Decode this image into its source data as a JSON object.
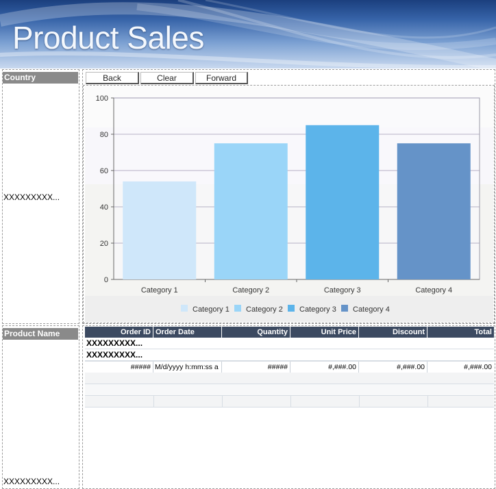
{
  "banner": {
    "title": "Product Sales"
  },
  "sidebar": {
    "country_label": "Country",
    "country_value": "XXXXXXXXX...",
    "product_label": "Product Name",
    "product_value": "XXXXXXXXX..."
  },
  "nav": {
    "back": "Back",
    "clear": "Clear",
    "forward": "Forward"
  },
  "chart_data": {
    "type": "bar",
    "categories": [
      "Category 1",
      "Category 2",
      "Category 3",
      "Category 4"
    ],
    "values": [
      54,
      75,
      85,
      75
    ],
    "colors": [
      "#cfe7fa",
      "#9ad5f8",
      "#5cb4ea",
      "#6593c8"
    ],
    "ylim": [
      0,
      100
    ],
    "yticks": [
      0,
      20,
      40,
      60,
      80,
      100
    ],
    "legend": [
      "Category 1",
      "Category 2",
      "Category 3",
      "Category 4"
    ],
    "legend_position": "bottom",
    "grid": true
  },
  "grid": {
    "headers": [
      "Order ID",
      "Order Date",
      "Quantity",
      "Unit Price",
      "Discount",
      "Total"
    ],
    "group1": "XXXXXXXXX...",
    "group2": "XXXXXXXXX...",
    "row": [
      "#####",
      "M/d/yyyy h:mm:ss a",
      "#####",
      "#,###.00",
      "#,###.00",
      "#,###.00"
    ]
  }
}
